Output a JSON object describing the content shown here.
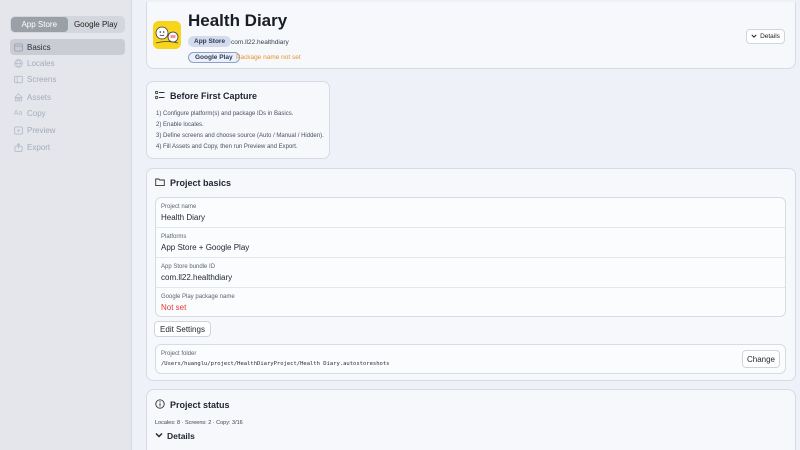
{
  "platform_switch": {
    "app_store": "App Store",
    "google_play": "Google Play"
  },
  "sidebar": {
    "items": [
      {
        "label": "Basics",
        "icon": "window-icon"
      },
      {
        "label": "Locales",
        "icon": "globe-icon"
      },
      {
        "label": "Screens",
        "icon": "screens-icon"
      },
      {
        "label": "Assets",
        "icon": "shapes-icon"
      },
      {
        "label": "Copy",
        "icon": "text-icon"
      },
      {
        "label": "Preview",
        "icon": "preview-icon"
      },
      {
        "label": "Export",
        "icon": "export-icon"
      }
    ]
  },
  "header": {
    "title": "Health Diary",
    "app_store_pill": "App Store",
    "bundle_id": "com.ll22.healthdiary",
    "google_play_pill": "Google Play",
    "package_warning": "Package name not set",
    "details_label": "Details"
  },
  "before_capture": {
    "title": "Before First Capture",
    "steps": [
      "1) Configure platform(s) and package IDs in Basics.",
      "2) Enable locales.",
      "3) Define screens and choose source (Auto / Manual / Hidden).",
      "4) Fill Assets and Copy, then run Preview and Export."
    ]
  },
  "basics": {
    "title": "Project basics",
    "fields": [
      {
        "label": "Project name",
        "value": "Health Diary"
      },
      {
        "label": "Platforms",
        "value": "App Store + Google Play"
      },
      {
        "label": "App Store bundle ID",
        "value": "com.ll22.healthdiary"
      },
      {
        "label": "Google Play package name",
        "value": "Not set"
      }
    ],
    "edit_label": "Edit Settings",
    "folder_label": "Project folder",
    "folder_path": "/Users/huanglu/project/HealthDiaryProject/Health Diary.autostoreshots",
    "change_label": "Change"
  },
  "status": {
    "title": "Project status",
    "summary": "Locales: 8 · Screens: 2 · Copy: 3/16",
    "details_label": "Details"
  },
  "colors": {
    "warning": "#e8932e",
    "error": "#e53935",
    "app_icon_bg": "#f7d51c"
  }
}
